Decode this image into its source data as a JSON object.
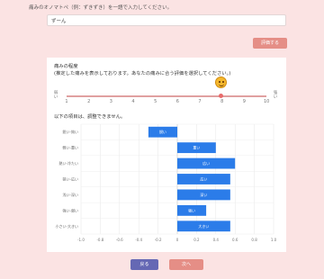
{
  "prompt": "痛みのオノマトペ（例：ずきずき）を一語で入力してください。",
  "answer_input": {
    "value": "ずーん"
  },
  "evaluate_button": "評価する",
  "card": {
    "title": "痛みの程度",
    "subtitle": "(推定した痛みを表示しております。あなたの痛みに合う評価を選択してください。)",
    "scale_left": "弱い",
    "scale_right": "強い",
    "ticks": [
      "1",
      "2",
      "3",
      "4",
      "5",
      "6",
      "7",
      "8",
      "9",
      "10"
    ],
    "selected": 8,
    "result_note": "以下の項目は、調整できません。"
  },
  "chart_data": {
    "type": "bar",
    "orientation": "horizontal",
    "categories": [
      "鋭い-鈍い",
      "軽い-重い",
      "熱い-冷たい",
      "狭い-広い",
      "浅い-深い",
      "強い-弱い",
      "小さい-大きい"
    ],
    "values": [
      -0.3,
      0.4,
      0.6,
      0.55,
      0.55,
      0.3,
      0.55
    ],
    "bar_labels": [
      "鋭い",
      "重い",
      "広い",
      "広い",
      "深い",
      "強い",
      "大きい"
    ],
    "xlim": [
      -1.0,
      1.0
    ],
    "xticks": [
      "-1.0",
      "-0.8",
      "-0.6",
      "-0.4",
      "-0.2",
      "0",
      "0.2",
      "0.4",
      "0.6",
      "0.8",
      "1.0"
    ],
    "grid": true,
    "bar_color": "#2b7ce9"
  },
  "buttons": {
    "back": "戻る",
    "next": "次へ"
  },
  "colors": {
    "background": "#fbe3e3",
    "accent": "#e58e86",
    "back": "#6568b4"
  }
}
